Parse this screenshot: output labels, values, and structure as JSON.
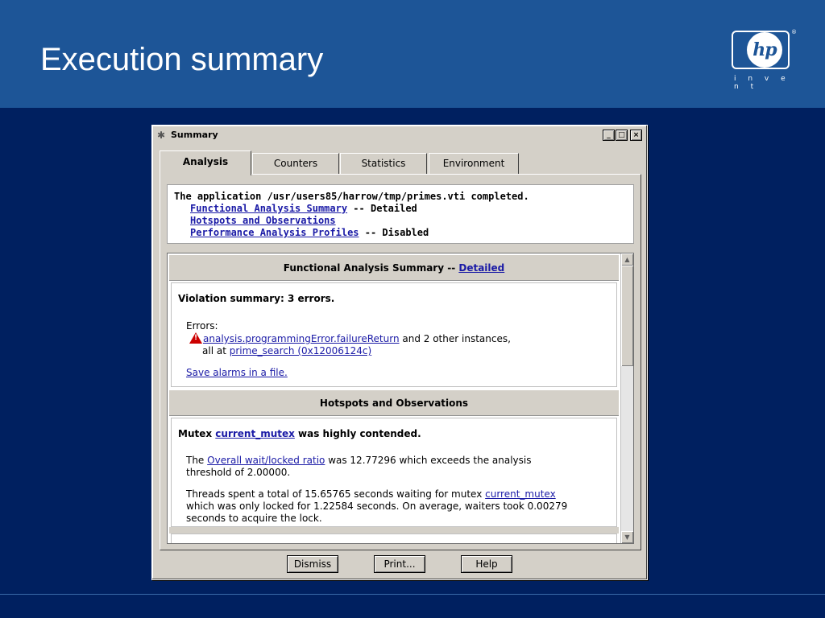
{
  "slide": {
    "title": "Execution summary",
    "logo": {
      "mark": "hp",
      "tagline": "i n v e n t",
      "registered": "®"
    }
  },
  "window": {
    "title": "Summary",
    "controls": {
      "minimize": "_",
      "maximize": "□",
      "close": "×"
    }
  },
  "tabs": [
    {
      "label": "Analysis",
      "active": true
    },
    {
      "label": "Counters",
      "active": false
    },
    {
      "label": "Statistics",
      "active": false
    },
    {
      "label": "Environment",
      "active": false
    }
  ],
  "info": {
    "line1": "The application /usr/users85/harrow/tmp/primes.vti completed.",
    "items": [
      {
        "link": "Functional Analysis Summary",
        "suffix": " -- Detailed"
      },
      {
        "link": "Hotspots and Observations",
        "suffix": ""
      },
      {
        "link": "Performance Analysis Profiles",
        "suffix": " -- Disabled"
      }
    ]
  },
  "functional": {
    "header_prefix": "Functional Analysis Summary -- ",
    "header_link": "Detailed",
    "violation": "Violation summary: 3 errors.",
    "errors_label": "Errors:",
    "error_link": "analysis.programmingError.failureReturn",
    "error_suffix": " and 2 other instances,",
    "at_prefix": "all at ",
    "at_link": "prime_search (0x12006124c)",
    "save_link": "Save alarms in a file."
  },
  "hotspots": {
    "header": "Hotspots and Observations",
    "mutex_prefix": "Mutex ",
    "mutex_link": "current_mutex",
    "mutex_suffix": " was highly contended.",
    "p1_prefix": "The ",
    "p1_link": "Overall wait/locked ratio",
    "p1_suffix": " was 12.77296 which exceeds the analysis",
    "p1_line2": "threshold of 2.00000.",
    "p2_line1_prefix": "Threads spent a total of 15.65765  seconds waiting for mutex ",
    "p2_link": "current_mutex",
    "p2_line2": "which was only locked for 1.22584 seconds.  On average, waiters took 0.00279",
    "p2_line3": "seconds to acquire the lock."
  },
  "buttons": {
    "dismiss": "Dismiss",
    "print": "Print...",
    "help": "Help"
  }
}
